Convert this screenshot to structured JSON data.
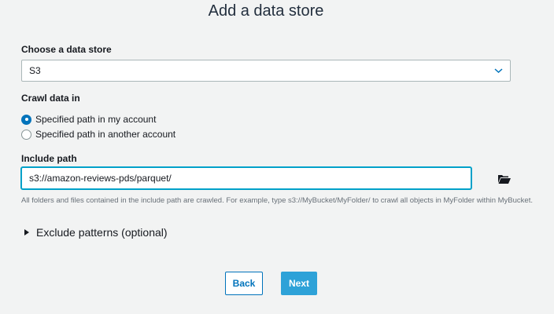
{
  "page": {
    "title": "Add a data store"
  },
  "data_store": {
    "label": "Choose a data store",
    "selected": "S3",
    "chevron_icon": "chevron-down-icon"
  },
  "crawl": {
    "label": "Crawl data in",
    "options": [
      {
        "label": "Specified path in my account",
        "checked": true
      },
      {
        "label": "Specified path in another account",
        "checked": false
      }
    ]
  },
  "include_path": {
    "label": "Include path",
    "value": "s3://amazon-reviews-pds/parquet/",
    "browse_icon": "folder-open-icon",
    "help_text": "All folders and files contained in the include path are crawled. For example, type s3://MyBucket/MyFolder/ to crawl all objects in MyFolder within MyBucket."
  },
  "exclude": {
    "label": "Exclude patterns (optional)",
    "expanded": false
  },
  "buttons": {
    "back": "Back",
    "next": "Next"
  },
  "colors": {
    "background": "#f2f3f3",
    "accent": "#0073bb",
    "primary_button": "#2ea2d8",
    "focus_border": "#00a1c9"
  }
}
